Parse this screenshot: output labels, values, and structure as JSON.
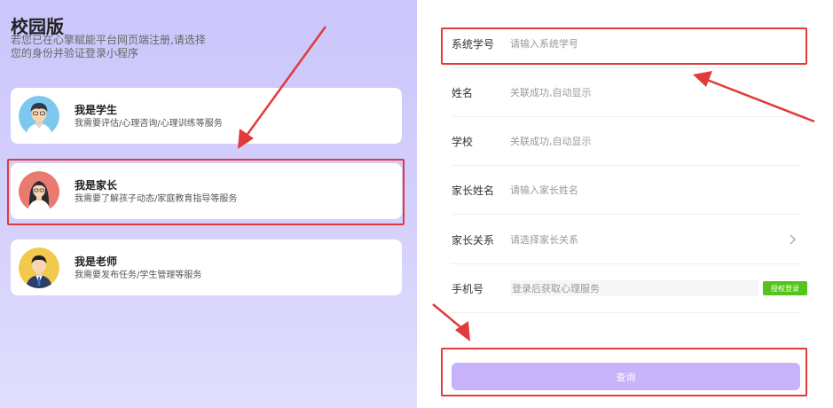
{
  "header": {
    "title": "校园版",
    "subtitle": "若您已在心擎赋能平台网页端注册,请选择您的身份并验证登录小程序"
  },
  "roles": [
    {
      "name": "我是学生",
      "desc": "我需要评估/心理咨询/心理训练等服务",
      "avatar_color": "#7ec8f0"
    },
    {
      "name": "我是家长",
      "desc": "我需要了解孩子动态/家庭教育指导等服务",
      "avatar_color": "#e87a6f"
    },
    {
      "name": "我是老师",
      "desc": "我需要发布任务/学生管理等服务",
      "avatar_color": "#f2c94c"
    }
  ],
  "form": {
    "fields": [
      {
        "label": "系统学号",
        "placeholder": "请输入系统学号"
      },
      {
        "label": "姓名",
        "placeholder": "关联成功,自动显示"
      },
      {
        "label": "学校",
        "placeholder": "关联成功,自动显示"
      },
      {
        "label": "家长姓名",
        "placeholder": "请输入家长姓名"
      },
      {
        "label": "家长关系",
        "placeholder": "请选择家长关系"
      },
      {
        "label": "手机号",
        "placeholder": "登录后获取心理服务"
      }
    ],
    "auth_button": "授权登录",
    "query_button": "查询"
  },
  "colors": {
    "accent_purple": "#c6b3f9",
    "auth_green": "#52c41a",
    "highlight_red": "#e13a3a"
  }
}
